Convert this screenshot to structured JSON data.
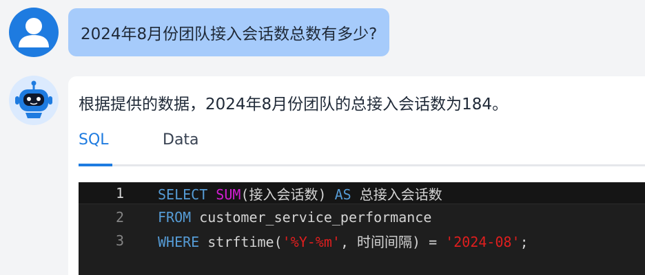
{
  "user_message": {
    "text": "2024年8月份团队接入会话数总数有多少?"
  },
  "bot_message": {
    "answer": "根据提供的数据，2024年8月份团队的总接入会话数为184。",
    "tabs": [
      {
        "label": "SQL",
        "active": true
      },
      {
        "label": "Data",
        "active": false
      }
    ],
    "code": {
      "line_numbers": [
        "1",
        "2",
        "3"
      ],
      "line1": {
        "kw1": "SELECT",
        "fn1": "SUM",
        "p1": "(接入会话数)",
        "kw2": "AS",
        "p2": "总接入会话数"
      },
      "line2": {
        "kw1": "FROM",
        "p1": "customer_service_performance"
      },
      "line3": {
        "kw1": "WHERE",
        "p1": "strftime(",
        "s1": "'%Y-%m'",
        "p2": ", 时间间隔)",
        "op": "=",
        "s2": "'2024-08'",
        "p3": ";"
      }
    }
  },
  "colors": {
    "accent": "#1e7be0",
    "user_bubble": "#a6cbfb",
    "keyword": "#569cd6",
    "function": "#d21dd2",
    "string": "#e01e1e",
    "code_bg": "#1e1e1e"
  }
}
